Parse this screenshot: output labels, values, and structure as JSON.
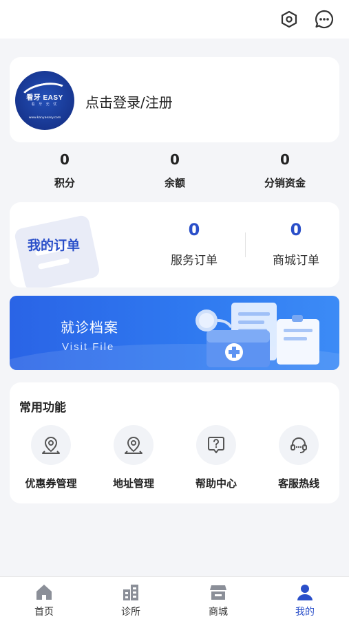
{
  "topbar": {
    "icons": [
      "settings-hex-icon",
      "message-icon"
    ]
  },
  "profile": {
    "logo_text": "看牙 EASY",
    "logo_sub": "看 牙 无 忧",
    "logo_url": "www.kanyaeasy.com",
    "login_label": "点击登录/注册"
  },
  "stats": [
    {
      "value": "0",
      "label": "积分"
    },
    {
      "value": "0",
      "label": "余额"
    },
    {
      "value": "0",
      "label": "分销资金"
    }
  ],
  "orders": {
    "title": "我的订单",
    "items": [
      {
        "value": "0",
        "label": "服务订单"
      },
      {
        "value": "0",
        "label": "商城订单"
      }
    ]
  },
  "banner": {
    "title": "就诊档案",
    "subtitle": "Visit File"
  },
  "functions": {
    "title": "常用功能",
    "items": [
      {
        "label": "优惠券管理",
        "icon": "coupon-pin-icon"
      },
      {
        "label": "地址管理",
        "icon": "location-pin-icon"
      },
      {
        "label": "帮助中心",
        "icon": "help-icon"
      },
      {
        "label": "客服热线",
        "icon": "headset-icon"
      }
    ]
  },
  "tabbar": {
    "items": [
      {
        "label": "首页",
        "icon": "home-icon",
        "active": false
      },
      {
        "label": "诊所",
        "icon": "clinic-icon",
        "active": false
      },
      {
        "label": "商城",
        "icon": "store-icon",
        "active": false
      },
      {
        "label": "我的",
        "icon": "user-icon",
        "active": true
      }
    ]
  },
  "colors": {
    "accent": "#2a4fc9",
    "banner_start": "#2a64e6",
    "banner_end": "#3c8bf6",
    "background": "#f4f5f8"
  }
}
